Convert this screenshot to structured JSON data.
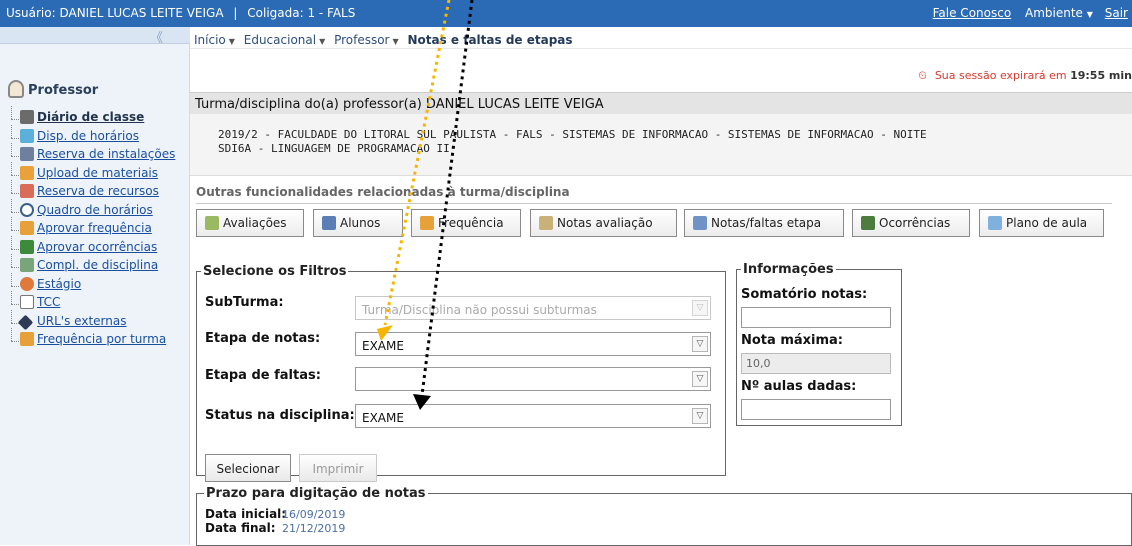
{
  "topbar": {
    "user_text": "Usuário: DANIEL LUCAS LEITE VEIGA",
    "sep": "|",
    "coligada_text": "Coligada: 1 - FALS",
    "contact_link": "Fale Conosco",
    "ambiente_menu": "Ambiente",
    "exit_link": "Sair"
  },
  "sidebar": {
    "collapse": "《",
    "title": "Professor",
    "items": [
      {
        "label": "Diário de classe",
        "icon": "book-icon"
      },
      {
        "label": "Disp. de horários",
        "icon": "calendar-icon"
      },
      {
        "label": "Reserva de instalações",
        "icon": "building-icon"
      },
      {
        "label": "Upload de materiais",
        "icon": "upload-icon"
      },
      {
        "label": "Reserva de recursos",
        "icon": "checkbox-icon"
      },
      {
        "label": "Quadro de horários",
        "icon": "clock-icon"
      },
      {
        "label": "Aprovar frequência",
        "icon": "attendance-icon"
      },
      {
        "label": "Aprovar ocorrências",
        "icon": "pen-icon"
      },
      {
        "label": "Compl. de disciplina",
        "icon": "discipline-icon"
      },
      {
        "label": "Estágio",
        "icon": "person-icon"
      },
      {
        "label": "TCC",
        "icon": "document-icon"
      },
      {
        "label": "URL's externas",
        "icon": "globe-icon"
      },
      {
        "label": "Frequência por turma",
        "icon": "attendance-icon"
      }
    ]
  },
  "breadcrumb": {
    "items": [
      "Início",
      "Educacional",
      "Professor"
    ],
    "current": "Notas e faltas de etapas"
  },
  "session": {
    "text": "Sua sessão expirará em",
    "time": "19:55 min"
  },
  "turma_section": {
    "title": "Turma/disciplina do(a) professor(a) DANIEL LUCAS LEITE VEIGA",
    "line1": "2019/2 - FACULDADE DO LITORAL SUL PAULISTA - FALS - SISTEMAS DE INFORMACAO - SISTEMAS DE INFORMACAO - NOITE",
    "line2": "SDI6A - LINGUAGEM DE PROGRAMACAO II"
  },
  "outras": {
    "title": "Outras funcionalidades relacionadas à turma/disciplina",
    "buttons": [
      {
        "label": "Avaliações",
        "icon": "evaluation-icon"
      },
      {
        "label": "Alunos",
        "icon": "students-icon"
      },
      {
        "label": "Frequência",
        "icon": "attendance-icon"
      },
      {
        "label": "Notas avaliação",
        "icon": "grades-icon"
      },
      {
        "label": "Notas/faltas etapa",
        "icon": "table-icon"
      },
      {
        "label": "Ocorrências",
        "icon": "pen-icon"
      },
      {
        "label": "Plano de aula",
        "icon": "plan-icon"
      }
    ]
  },
  "filters": {
    "legend": "Selecione os Filtros",
    "subturma_label": "SubTurma:",
    "subturma_value": "Turma/Disciplina não possui subturmas",
    "etapa_notas_label": "Etapa de notas:",
    "etapa_notas_value": "EXAME",
    "etapa_faltas_label": "Etapa de faltas:",
    "etapa_faltas_value": "",
    "status_label": "Status na disciplina:",
    "status_value": "EXAME",
    "select_button": "Selecionar",
    "print_button": "Imprimir"
  },
  "info": {
    "legend": "Informações",
    "somatorio_label": "Somatório notas:",
    "somatorio_value": "",
    "nota_max_label": "Nota máxima:",
    "nota_max_value": "10,0",
    "aulas_label": "Nº aulas dadas:",
    "aulas_value": ""
  },
  "prazo": {
    "legend": "Prazo para digitação de notas",
    "inicial_label": "Data inicial:",
    "inicial_value": "16/09/2019",
    "final_label": "Data final:",
    "final_value": "21/12/2019"
  },
  "colors": {
    "topbar": "#2b6bb5",
    "annotation_yellow": "#f7b500",
    "annotation_black": "#000000",
    "session_red": "#d83a2f"
  }
}
